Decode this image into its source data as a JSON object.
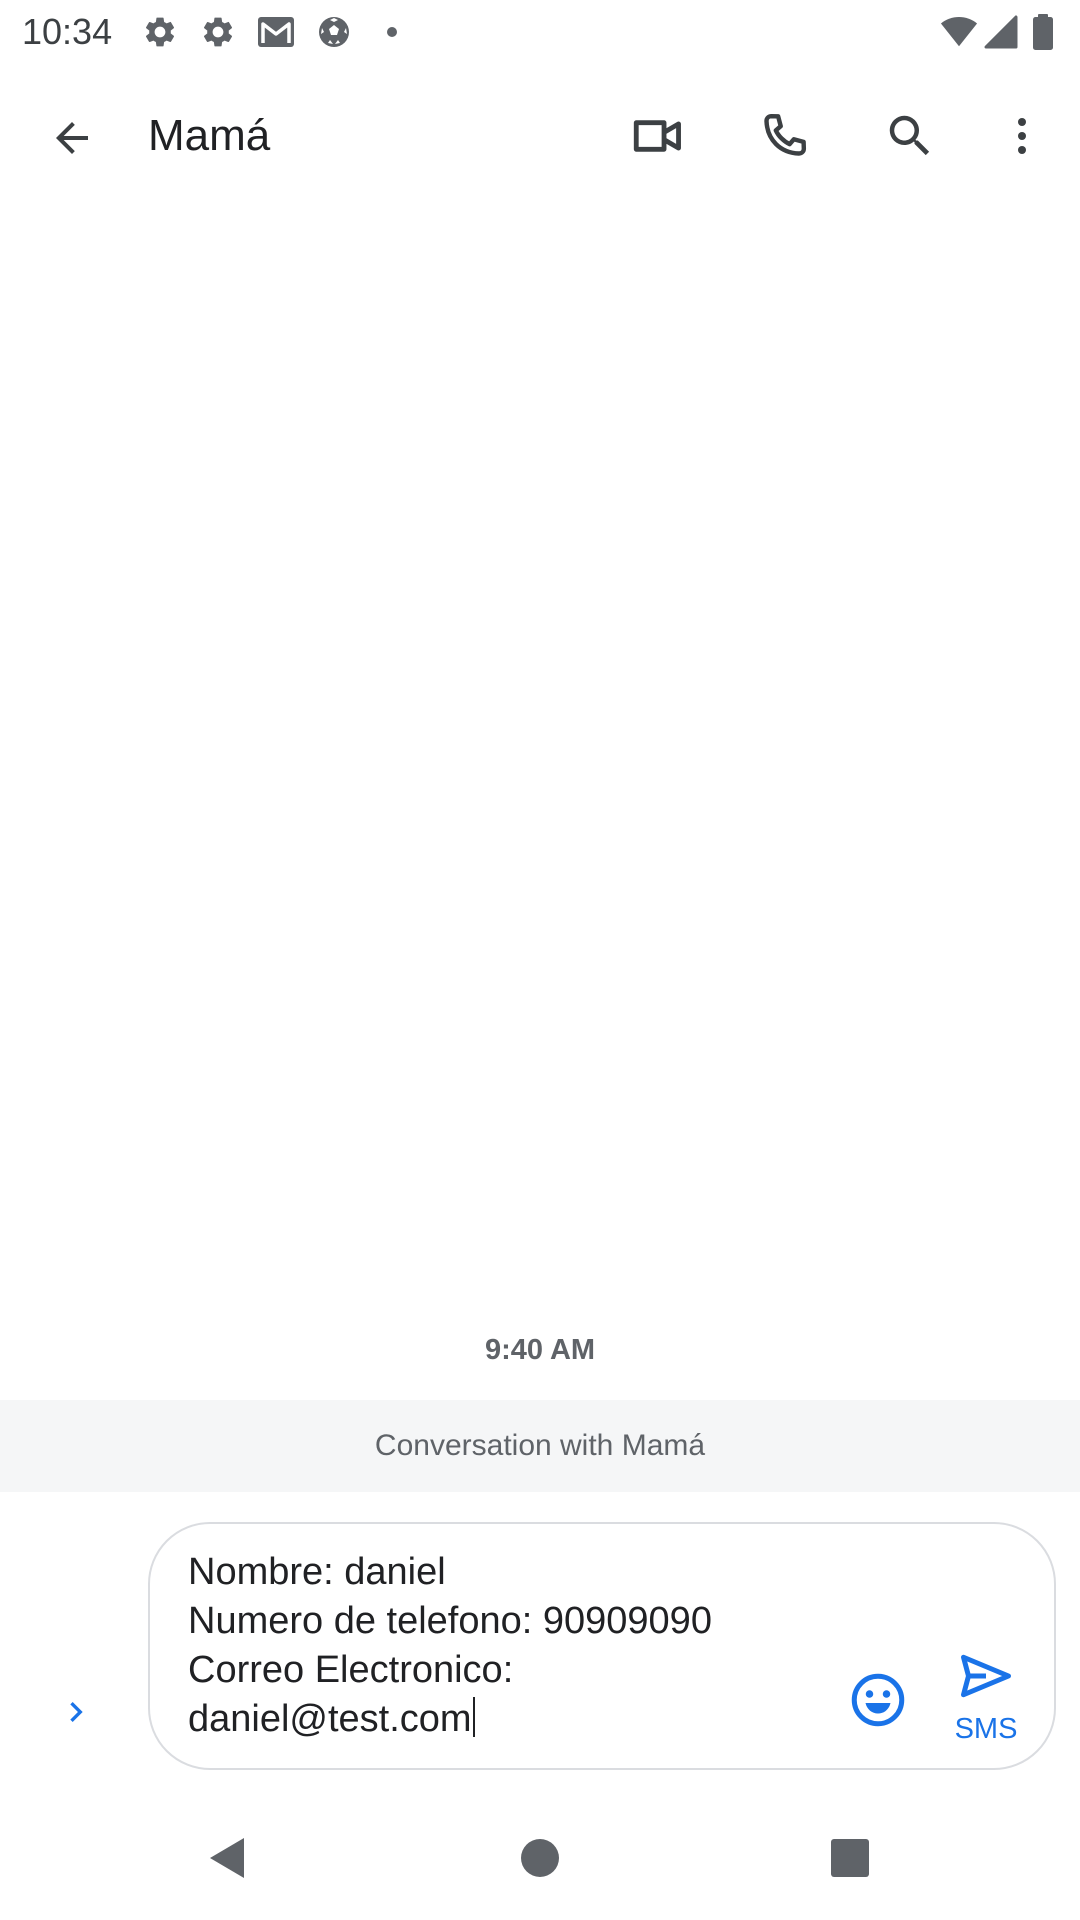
{
  "status_bar": {
    "time": "10:34",
    "left_icons": [
      "settings-icon",
      "settings-icon",
      "gmail-icon",
      "soccer-ball-icon",
      "dot-icon"
    ],
    "right_icons": [
      "wifi-icon",
      "cell-signal-icon",
      "battery-icon"
    ]
  },
  "app_bar": {
    "title": "Mamá",
    "actions": [
      "video-call-icon",
      "phone-icon",
      "search-icon",
      "more-vert-icon"
    ]
  },
  "conversation": {
    "timestamp": "9:40 AM",
    "banner": "Conversation with Mamá"
  },
  "compose": {
    "text": "Nombre: daniel\nNumero de telefono: 90909090\nCorreo Electronico:\ndaniel@test.com",
    "send_label": "SMS"
  },
  "colors": {
    "accent": "#1a73e8",
    "icon": "#3c4043",
    "banner_bg": "#f5f6f7"
  }
}
